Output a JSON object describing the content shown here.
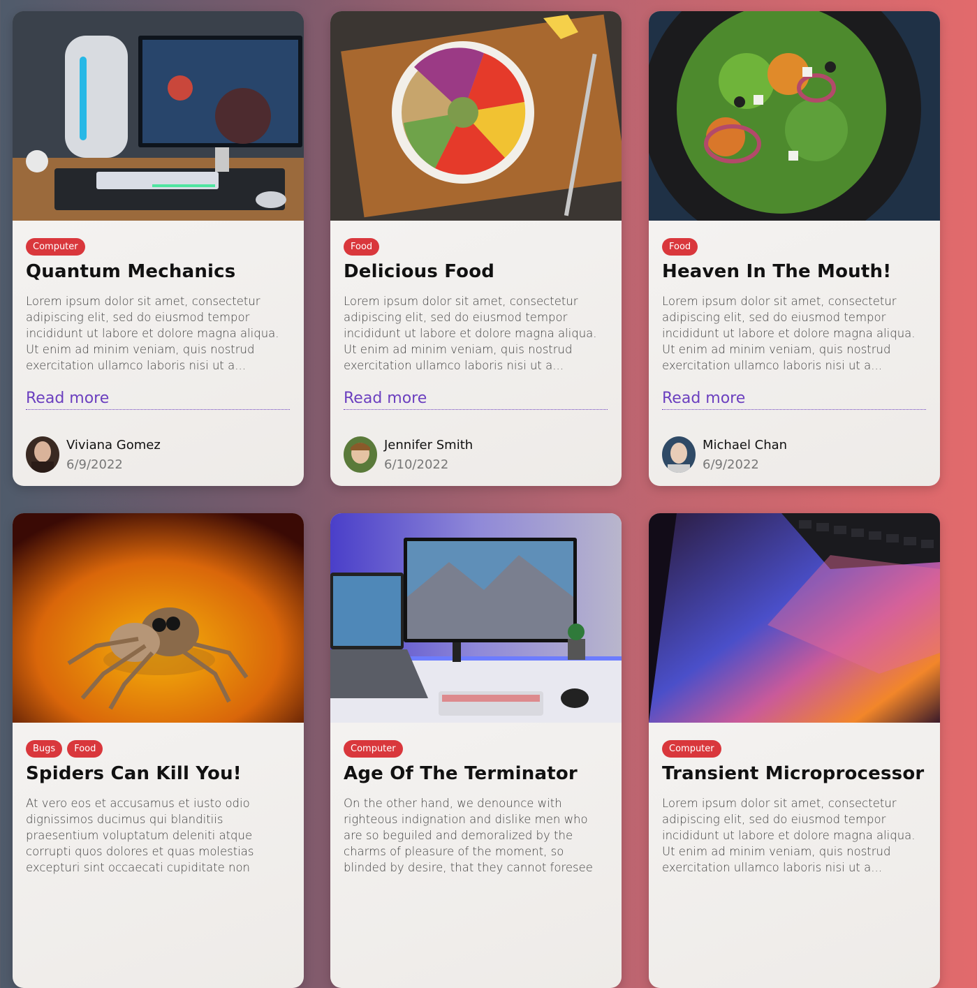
{
  "colors": {
    "tag_bg": "#d9373c",
    "link": "#6b3fbf",
    "card_bg": "#f3f1ef"
  },
  "cards": [
    {
      "tags": [
        "Computer"
      ],
      "title": "Quantum Mechanics",
      "excerpt": "Lorem ipsum dolor sit amet, consectetur adipiscing elit, sed do eiusmod tempor incididunt ut labore et dolore magna aliqua. Ut enim ad minim veniam, quis nostrud exercitation ullamco laboris nisi ut a...",
      "read_more": "Read more",
      "author": {
        "name": "Viviana Gomez",
        "date": "6/9/2022"
      },
      "image": "gaming-pc-desk-photo"
    },
    {
      "tags": [
        "Food"
      ],
      "title": "Delicious Food",
      "excerpt": "Lorem ipsum dolor sit amet, consectetur adipiscing elit, sed do eiusmod tempor incididunt ut labore et dolore magna aliqua. Ut enim ad minim veniam, quis nostrud exercitation ullamco laboris nisi ut a...",
      "read_more": "Read more",
      "author": {
        "name": "Jennifer Smith",
        "date": "6/10/2022"
      },
      "image": "salad-bowl-photo"
    },
    {
      "tags": [
        "Food"
      ],
      "title": "Heaven In The Mouth!",
      "excerpt": "Lorem ipsum dolor sit amet, consectetur adipiscing elit, sed do eiusmod tempor incididunt ut labore et dolore magna aliqua. Ut enim ad minim veniam, quis nostrud exercitation ullamco laboris nisi ut a...",
      "read_more": "Read more",
      "author": {
        "name": "Michael Chan",
        "date": "6/9/2022"
      },
      "image": "salad-plate-photo"
    },
    {
      "tags": [
        "Bugs",
        "Food"
      ],
      "title": "Spiders Can Kill You!",
      "excerpt": "At vero eos et accusamus et iusto odio dignissimos ducimus qui blanditiis praesentium voluptatum deleniti atque corrupti quos dolores et quas molestias excepturi sint occaecati cupiditate non",
      "image": "jumping-spider-photo"
    },
    {
      "tags": [
        "Computer"
      ],
      "title": "Age Of The Terminator",
      "excerpt": "On the other hand, we denounce with righteous indignation and dislike men who are so beguiled and demoralized by the charms of pleasure of the moment, so blinded by desire, that they cannot foresee",
      "image": "desk-setup-photo"
    },
    {
      "tags": [
        "Computer"
      ],
      "title": "Transient Microprocessor",
      "excerpt": "Lorem ipsum dolor sit amet, consectetur adipiscing elit, sed do eiusmod tempor incididunt ut labore et dolore magna aliqua. Ut enim ad minim veniam, quis nostrud exercitation ullamco laboris nisi ut a...",
      "image": "laptop-keyboard-photo"
    }
  ]
}
